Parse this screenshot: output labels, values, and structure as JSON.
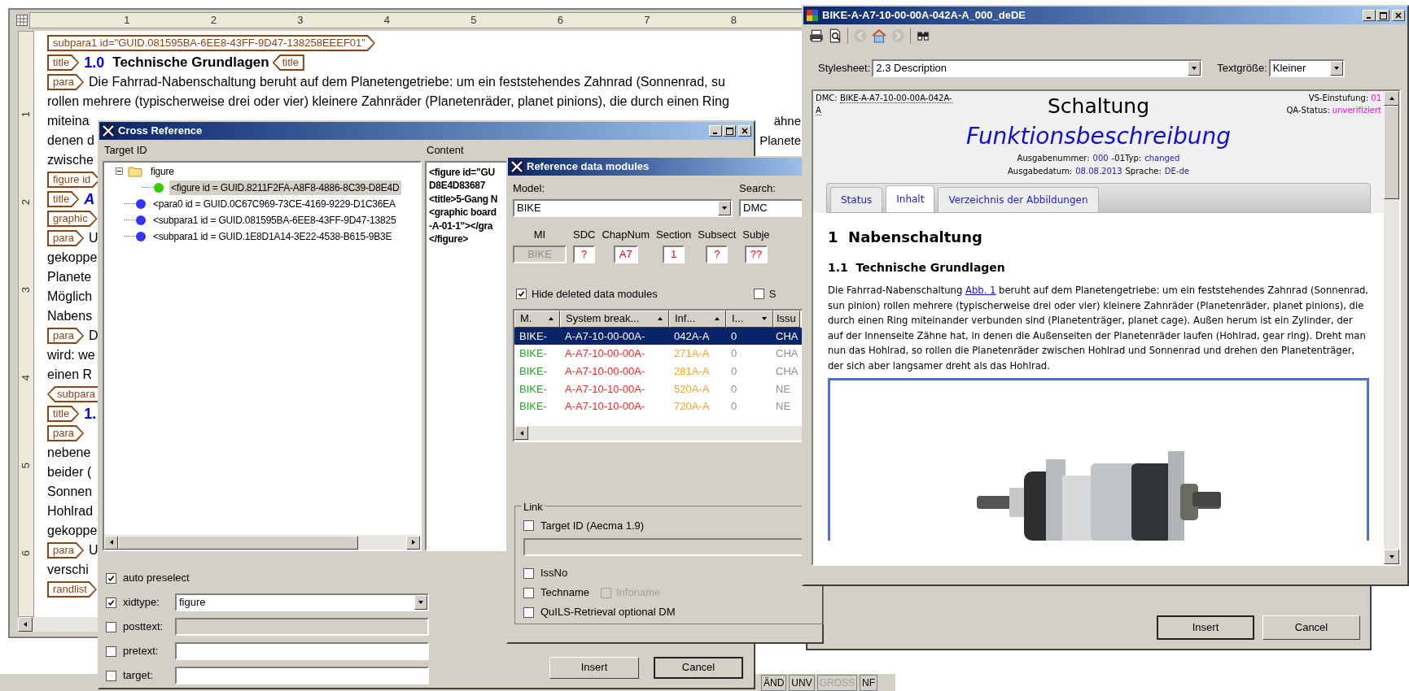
{
  "editor": {
    "ruler_marks": [
      "1",
      "2",
      "3",
      "4",
      "5",
      "6",
      "7",
      "8"
    ],
    "side_ruler_marks": [
      "1",
      "2",
      "3",
      "4",
      "5",
      "6"
    ],
    "lines": [
      {
        "parts": [
          {
            "kind": "tag",
            "text": "subpara1 id=\"GUID.081595BA-6EE8-43FF-9D47-138258EEEF01\"",
            "closing": false
          }
        ]
      },
      {
        "parts": [
          {
            "kind": "tag",
            "text": "title",
            "closing": false
          },
          {
            "kind": "number",
            "text": "1.0",
            "italic": false
          },
          {
            "kind": "text",
            "text": "Technische Grundlagen",
            "bold": true
          },
          {
            "kind": "tag",
            "text": "title",
            "closing": true
          }
        ]
      },
      {
        "parts": [
          {
            "kind": "tag",
            "text": "para",
            "closing": false
          },
          {
            "kind": "text",
            "text": "Die Fahrrad-Nabenschaltung beruht auf dem Planetengetriebe: um ein feststehendes Zahnrad (Sonnenrad, su",
            "bold": false
          }
        ]
      },
      {
        "parts": [
          {
            "kind": "text",
            "text": "rollen mehrere (typischerweise drei oder vier) kleinere Zahnräder (Planetenräder, planet pinions), die durch einen Ring",
            "bold": false
          }
        ]
      },
      {
        "parts": [
          {
            "kind": "text",
            "text": "miteina",
            "bold": false
          },
          {
            "kind": "right",
            "text": "ähne"
          }
        ]
      },
      {
        "parts": [
          {
            "kind": "text",
            "text": "denen d",
            "bold": false
          },
          {
            "kind": "right",
            "text": "Planete"
          }
        ]
      },
      {
        "parts": [
          {
            "kind": "text",
            "text": "zwische",
            "bold": false
          }
        ]
      },
      {
        "parts": [
          {
            "kind": "tag",
            "text": "figure id",
            "closing": false
          }
        ]
      },
      {
        "parts": [
          {
            "kind": "tag",
            "text": "title",
            "closing": false
          },
          {
            "kind": "number",
            "text": "A",
            "italic": true
          }
        ]
      },
      {
        "parts": [
          {
            "kind": "tag",
            "text": "graphic",
            "closing": false
          }
        ]
      },
      {
        "parts": [
          {
            "kind": "tag",
            "text": "para",
            "closing": false
          },
          {
            "kind": "text",
            "text": "U",
            "bold": false
          }
        ]
      },
      {
        "parts": [
          {
            "kind": "text",
            "text": "gekoppe",
            "bold": false
          }
        ]
      },
      {
        "parts": [
          {
            "kind": "text",
            "text": "Planete",
            "bold": false
          }
        ]
      },
      {
        "parts": [
          {
            "kind": "text",
            "text": "Möglich",
            "bold": false
          }
        ]
      },
      {
        "parts": [
          {
            "kind": "text",
            "text": "Nabens",
            "bold": false
          }
        ]
      },
      {
        "parts": [
          {
            "kind": "tag",
            "text": "para",
            "closing": false
          },
          {
            "kind": "text",
            "text": "D",
            "bold": false
          }
        ]
      },
      {
        "parts": [
          {
            "kind": "text",
            "text": "wird: we",
            "bold": false
          }
        ]
      },
      {
        "parts": [
          {
            "kind": "text",
            "text": "einen R",
            "bold": false
          }
        ]
      },
      {
        "parts": [
          {
            "kind": "tag",
            "text": "subpara",
            "closing": true
          }
        ]
      },
      {
        "parts": [
          {
            "kind": "tag",
            "text": "title",
            "closing": false
          },
          {
            "kind": "number",
            "text": "1.",
            "italic": false
          }
        ]
      },
      {
        "parts": [
          {
            "kind": "tag",
            "text": "para",
            "closing": false
          }
        ]
      },
      {
        "parts": [
          {
            "kind": "text",
            "text": "nebene",
            "bold": false
          }
        ]
      },
      {
        "parts": [
          {
            "kind": "text",
            "text": "beider (",
            "bold": false
          }
        ]
      },
      {
        "parts": [
          {
            "kind": "text",
            "text": "Sonnen",
            "bold": false
          }
        ]
      },
      {
        "parts": [
          {
            "kind": "text",
            "text": "Hohlrad",
            "bold": false
          }
        ]
      },
      {
        "parts": [
          {
            "kind": "text",
            "text": "gekoppe",
            "bold": false
          }
        ]
      },
      {
        "parts": [
          {
            "kind": "tag",
            "text": "para",
            "closing": false
          },
          {
            "kind": "text",
            "text": "U",
            "bold": false
          }
        ]
      },
      {
        "parts": [
          {
            "kind": "text",
            "text": "verschi",
            "bold": false
          }
        ]
      },
      {
        "parts": [
          {
            "kind": "tag",
            "text": "randlist",
            "closing": false
          }
        ]
      }
    ]
  },
  "status_bar": [
    {
      "text": "ÄND",
      "disabled": false
    },
    {
      "text": "UNV",
      "disabled": false
    },
    {
      "text": "GROSS",
      "disabled": true
    },
    {
      "text": "NF",
      "disabled": false
    }
  ],
  "cross_reference": {
    "title": "Cross Reference",
    "target_label": "Target ID",
    "content_label": "Content",
    "tree": [
      {
        "label": "figure",
        "kind": "folder",
        "expanded": true,
        "selected": false,
        "children": [
          {
            "label": "<figure id = GUID.8211F2FA-A8F8-4886-8C39-D8E4D",
            "kind": "node",
            "color": "#33cc00",
            "selected": true
          }
        ]
      },
      {
        "label": "<para0 id = GUID.0C67C969-73CE-4169-9229-D1C36EA",
        "kind": "node",
        "color": "#3333ff",
        "selected": false
      },
      {
        "label": "<subpara1 id = GUID.081595BA-6EE8-43FF-9D47-13825",
        "kind": "node",
        "color": "#3333ff",
        "selected": false
      },
      {
        "label": "<subpara1 id = GUID.1E8D1A14-3E22-4538-B615-9B3E",
        "kind": "node",
        "color": "#3333ff",
        "selected": false
      }
    ],
    "content_lines": [
      "<figure id=\"GU",
      "D8E4D83687",
      "<title>5-Gang N",
      "<graphic board",
      "-A-01-1\"></gra",
      "</figure>"
    ],
    "options": [
      {
        "kind": "plain",
        "label": "auto preselect",
        "checked": true
      },
      {
        "kind": "dropdown",
        "label": "xidtype:",
        "checked": true,
        "value": "figure"
      },
      {
        "kind": "field",
        "label": "posttext:",
        "checked": false,
        "disabled": true
      },
      {
        "kind": "field",
        "label": "pretext:",
        "checked": false,
        "disabled": false
      },
      {
        "kind": "field",
        "label": "target:",
        "checked": false,
        "disabled": false
      }
    ],
    "buttons": [
      "Insert",
      "Cancel"
    ]
  },
  "reference_data_modules": {
    "title": "Reference data modules",
    "model": {
      "label": "Model:",
      "value": "BIKE"
    },
    "search": {
      "label": "Search:",
      "value": "DMC"
    },
    "codes": [
      {
        "label": "MI",
        "value": "BIKE",
        "disabled": true
      },
      {
        "label": "SDC",
        "value": "?",
        "disabled": false
      },
      {
        "label": "ChapNum",
        "value": "A7",
        "disabled": false
      },
      {
        "label": "Section",
        "value": "1",
        "disabled": false
      },
      {
        "label": "Subsect",
        "value": "?",
        "disabled": false
      },
      {
        "label": "Subje",
        "value": "??",
        "disabled": false
      }
    ],
    "hide_deleted": {
      "label": "Hide deleted data modules",
      "checked": true
    },
    "second_option": {
      "label": "S",
      "checked": false
    },
    "columns": [
      {
        "label": "M.",
        "sort_ascending": true
      },
      {
        "label": "System break...",
        "sort_ascending": true
      },
      {
        "label": "Inf...",
        "sort_ascending": true
      },
      {
        "label": "I...",
        "sort_ascending": false
      },
      {
        "label": "Issu"
      }
    ],
    "rows": [
      {
        "selected": true,
        "cells": [
          "BIKE-",
          "A-A7-10-00-00A-",
          "042A-A",
          "0",
          "CHA"
        ]
      },
      {
        "selected": false,
        "cells": [
          "BIKE-",
          "A-A7-10-00-00A-",
          "271A-A",
          "0",
          "CHA"
        ]
      },
      {
        "selected": false,
        "cells": [
          "BIKE-",
          "A-A7-10-00-00A-",
          "281A-A",
          "0",
          "CHA"
        ]
      },
      {
        "selected": false,
        "cells": [
          "BIKE-",
          "A-A7-10-10-00A-",
          "520A-A",
          "0",
          "NE"
        ]
      },
      {
        "selected": false,
        "cells": [
          "BIKE-",
          "A-A7-10-10-00A-",
          "720A-A",
          "0",
          "NE"
        ]
      }
    ],
    "link": {
      "legend": "Link",
      "target_id": {
        "label": "Target ID (Aecma 1.9)",
        "checked": false
      },
      "options": [
        {
          "label": "IssNo",
          "checked": false
        },
        {
          "label": "Techname",
          "checked": false,
          "extra": {
            "label": "Infoname",
            "checked": false,
            "disabled": true
          }
        },
        {
          "label": "QuILS-Retrieval optional DM",
          "checked": false
        }
      ]
    }
  },
  "back_dialog": {
    "buttons": [
      "Insert",
      "Cancel"
    ]
  },
  "viewer": {
    "title": "BIKE-A-A7-10-00-00A-042A-A_000_deDE",
    "toolbar": [
      {
        "kind": "printer",
        "disabled": false
      },
      {
        "kind": "preview",
        "disabled": false
      },
      {
        "kind": "back",
        "disabled": true
      },
      {
        "kind": "home",
        "disabled": false
      },
      {
        "kind": "forward",
        "disabled": true
      },
      {
        "kind": "find",
        "disabled": false
      }
    ],
    "stylesheet": {
      "label": "Stylesheet:",
      "value": "2.3 Description"
    },
    "text_size": {
      "label": "Textgröße:",
      "value": "Kleiner"
    },
    "header": {
      "dmc_label": "DMC:",
      "dmc_value": "BIKE-A-A7-10-00-00A-042A-A",
      "title": "Schaltung",
      "subtitle": "Funktionsbeschreibung",
      "right": [
        {
          "label": "VS-Einstufung:",
          "value": "01"
        },
        {
          "label": "QA-Status:",
          "value": "unverifiziert"
        }
      ],
      "meta": [
        [
          {
            "kind": "label",
            "text": "Ausgabenummer:"
          },
          {
            "kind": "value",
            "text": "000"
          },
          {
            "kind": "label",
            "text": "-01Typ:"
          },
          {
            "kind": "value",
            "text": "changed"
          }
        ],
        [
          {
            "kind": "label",
            "text": "Ausgabedatum:"
          },
          {
            "kind": "value",
            "text": "08.08.2013"
          },
          {
            "kind": "label",
            "text": "Sprache:"
          },
          {
            "kind": "value",
            "text": "DE-de"
          }
        ]
      ]
    },
    "tabs": [
      {
        "label": "Status",
        "selected": false
      },
      {
        "label": "Inhalt",
        "selected": true
      },
      {
        "label": "Verzeichnis der Abbildungen",
        "selected": false
      }
    ],
    "heading": {
      "number": "1",
      "text": "Nabenschaltung"
    },
    "subheading": {
      "number": "1.1",
      "text": "Technische Grundlagen"
    },
    "paragraph": {
      "before": "Die Fahrrad-Nabenschaltung",
      "link": "Abb. 1",
      "after": "beruht auf dem Planetengetriebe: um ein feststehendes Zahnrad (Sonnenrad, sun pinion) rollen mehrere (typischerweise drei oder vier) kleinere Zahnräder (Planetenräder, planet pinions), die durch einen Ring miteinander verbunden sind (Planetenträger, planet cage). Außen herum ist ein Zylinder, der auf der Innenseite Zähne hat, in denen die Außenseiten der Planetenräder laufen (Hohlrad, gear ring). Dreht man nun das Hohlrad, so rollen die Planetenräder zwischen Hohlrad und Sonnenrad und drehen den Planetenträger, der sich aber langsamer dreht als das Hohlrad."
    }
  }
}
